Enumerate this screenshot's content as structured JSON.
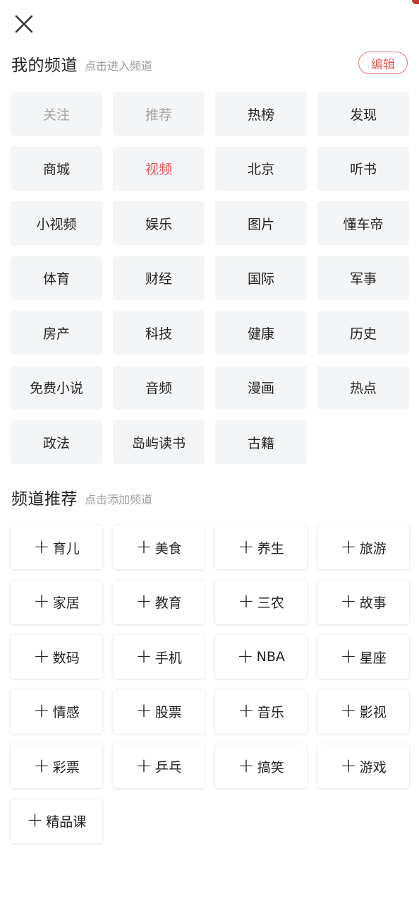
{
  "header": {
    "close_icon": "close-icon"
  },
  "my_channels": {
    "title": "我的频道",
    "hint": "点击进入频道",
    "edit_label": "编辑",
    "items": [
      {
        "label": "关注",
        "state": "fixed"
      },
      {
        "label": "推荐",
        "state": "fixed"
      },
      {
        "label": "热榜",
        "state": "normal"
      },
      {
        "label": "发现",
        "state": "normal"
      },
      {
        "label": "商城",
        "state": "normal"
      },
      {
        "label": "视频",
        "state": "active"
      },
      {
        "label": "北京",
        "state": "normal"
      },
      {
        "label": "听书",
        "state": "normal"
      },
      {
        "label": "小视频",
        "state": "normal"
      },
      {
        "label": "娱乐",
        "state": "normal"
      },
      {
        "label": "图片",
        "state": "normal"
      },
      {
        "label": "懂车帝",
        "state": "normal"
      },
      {
        "label": "体育",
        "state": "normal"
      },
      {
        "label": "财经",
        "state": "normal"
      },
      {
        "label": "国际",
        "state": "normal"
      },
      {
        "label": "军事",
        "state": "normal"
      },
      {
        "label": "房产",
        "state": "normal"
      },
      {
        "label": "科技",
        "state": "normal"
      },
      {
        "label": "健康",
        "state": "normal"
      },
      {
        "label": "历史",
        "state": "normal"
      },
      {
        "label": "免费小说",
        "state": "normal"
      },
      {
        "label": "音频",
        "state": "normal"
      },
      {
        "label": "漫画",
        "state": "normal"
      },
      {
        "label": "热点",
        "state": "normal"
      },
      {
        "label": "政法",
        "state": "normal"
      },
      {
        "label": "岛屿读书",
        "state": "normal"
      },
      {
        "label": "古籍",
        "state": "normal"
      }
    ]
  },
  "recommended": {
    "title": "频道推荐",
    "hint": "点击添加频道",
    "plus_icon": "plus-icon",
    "items": [
      {
        "label": "育儿"
      },
      {
        "label": "美食"
      },
      {
        "label": "养生"
      },
      {
        "label": "旅游"
      },
      {
        "label": "家居"
      },
      {
        "label": "教育"
      },
      {
        "label": "三农"
      },
      {
        "label": "故事"
      },
      {
        "label": "数码"
      },
      {
        "label": "手机"
      },
      {
        "label": "NBA"
      },
      {
        "label": "星座"
      },
      {
        "label": "情感"
      },
      {
        "label": "股票"
      },
      {
        "label": "音乐"
      },
      {
        "label": "影视"
      },
      {
        "label": "彩票"
      },
      {
        "label": "乒乓"
      },
      {
        "label": "搞笑"
      },
      {
        "label": "游戏"
      },
      {
        "label": "精品课"
      }
    ]
  },
  "colors": {
    "accent": "#e05a5a",
    "chip_bg": "#f4f5f6",
    "muted_text": "#a3a3a3",
    "text": "#222222"
  }
}
